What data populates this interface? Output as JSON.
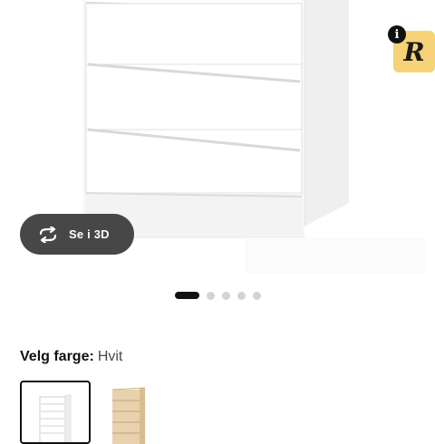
{
  "product": {
    "view_3d": {
      "label": "Se i 3D",
      "icon": "rotate-3d-icon"
    },
    "badge": {
      "letter": "R",
      "info": "i",
      "color": "#f6d376"
    }
  },
  "carousel": {
    "total": 5,
    "active": 1
  },
  "color_picker": {
    "label": "Velg farge:",
    "value": "Hvit",
    "swatches": [
      {
        "name": "Hvit",
        "selected": true
      },
      {
        "name": "Bjørk",
        "selected": false
      }
    ]
  },
  "colors": {
    "accent": "#111111",
    "pill": "#474747",
    "dot_inactive": "#d3d3d3"
  }
}
